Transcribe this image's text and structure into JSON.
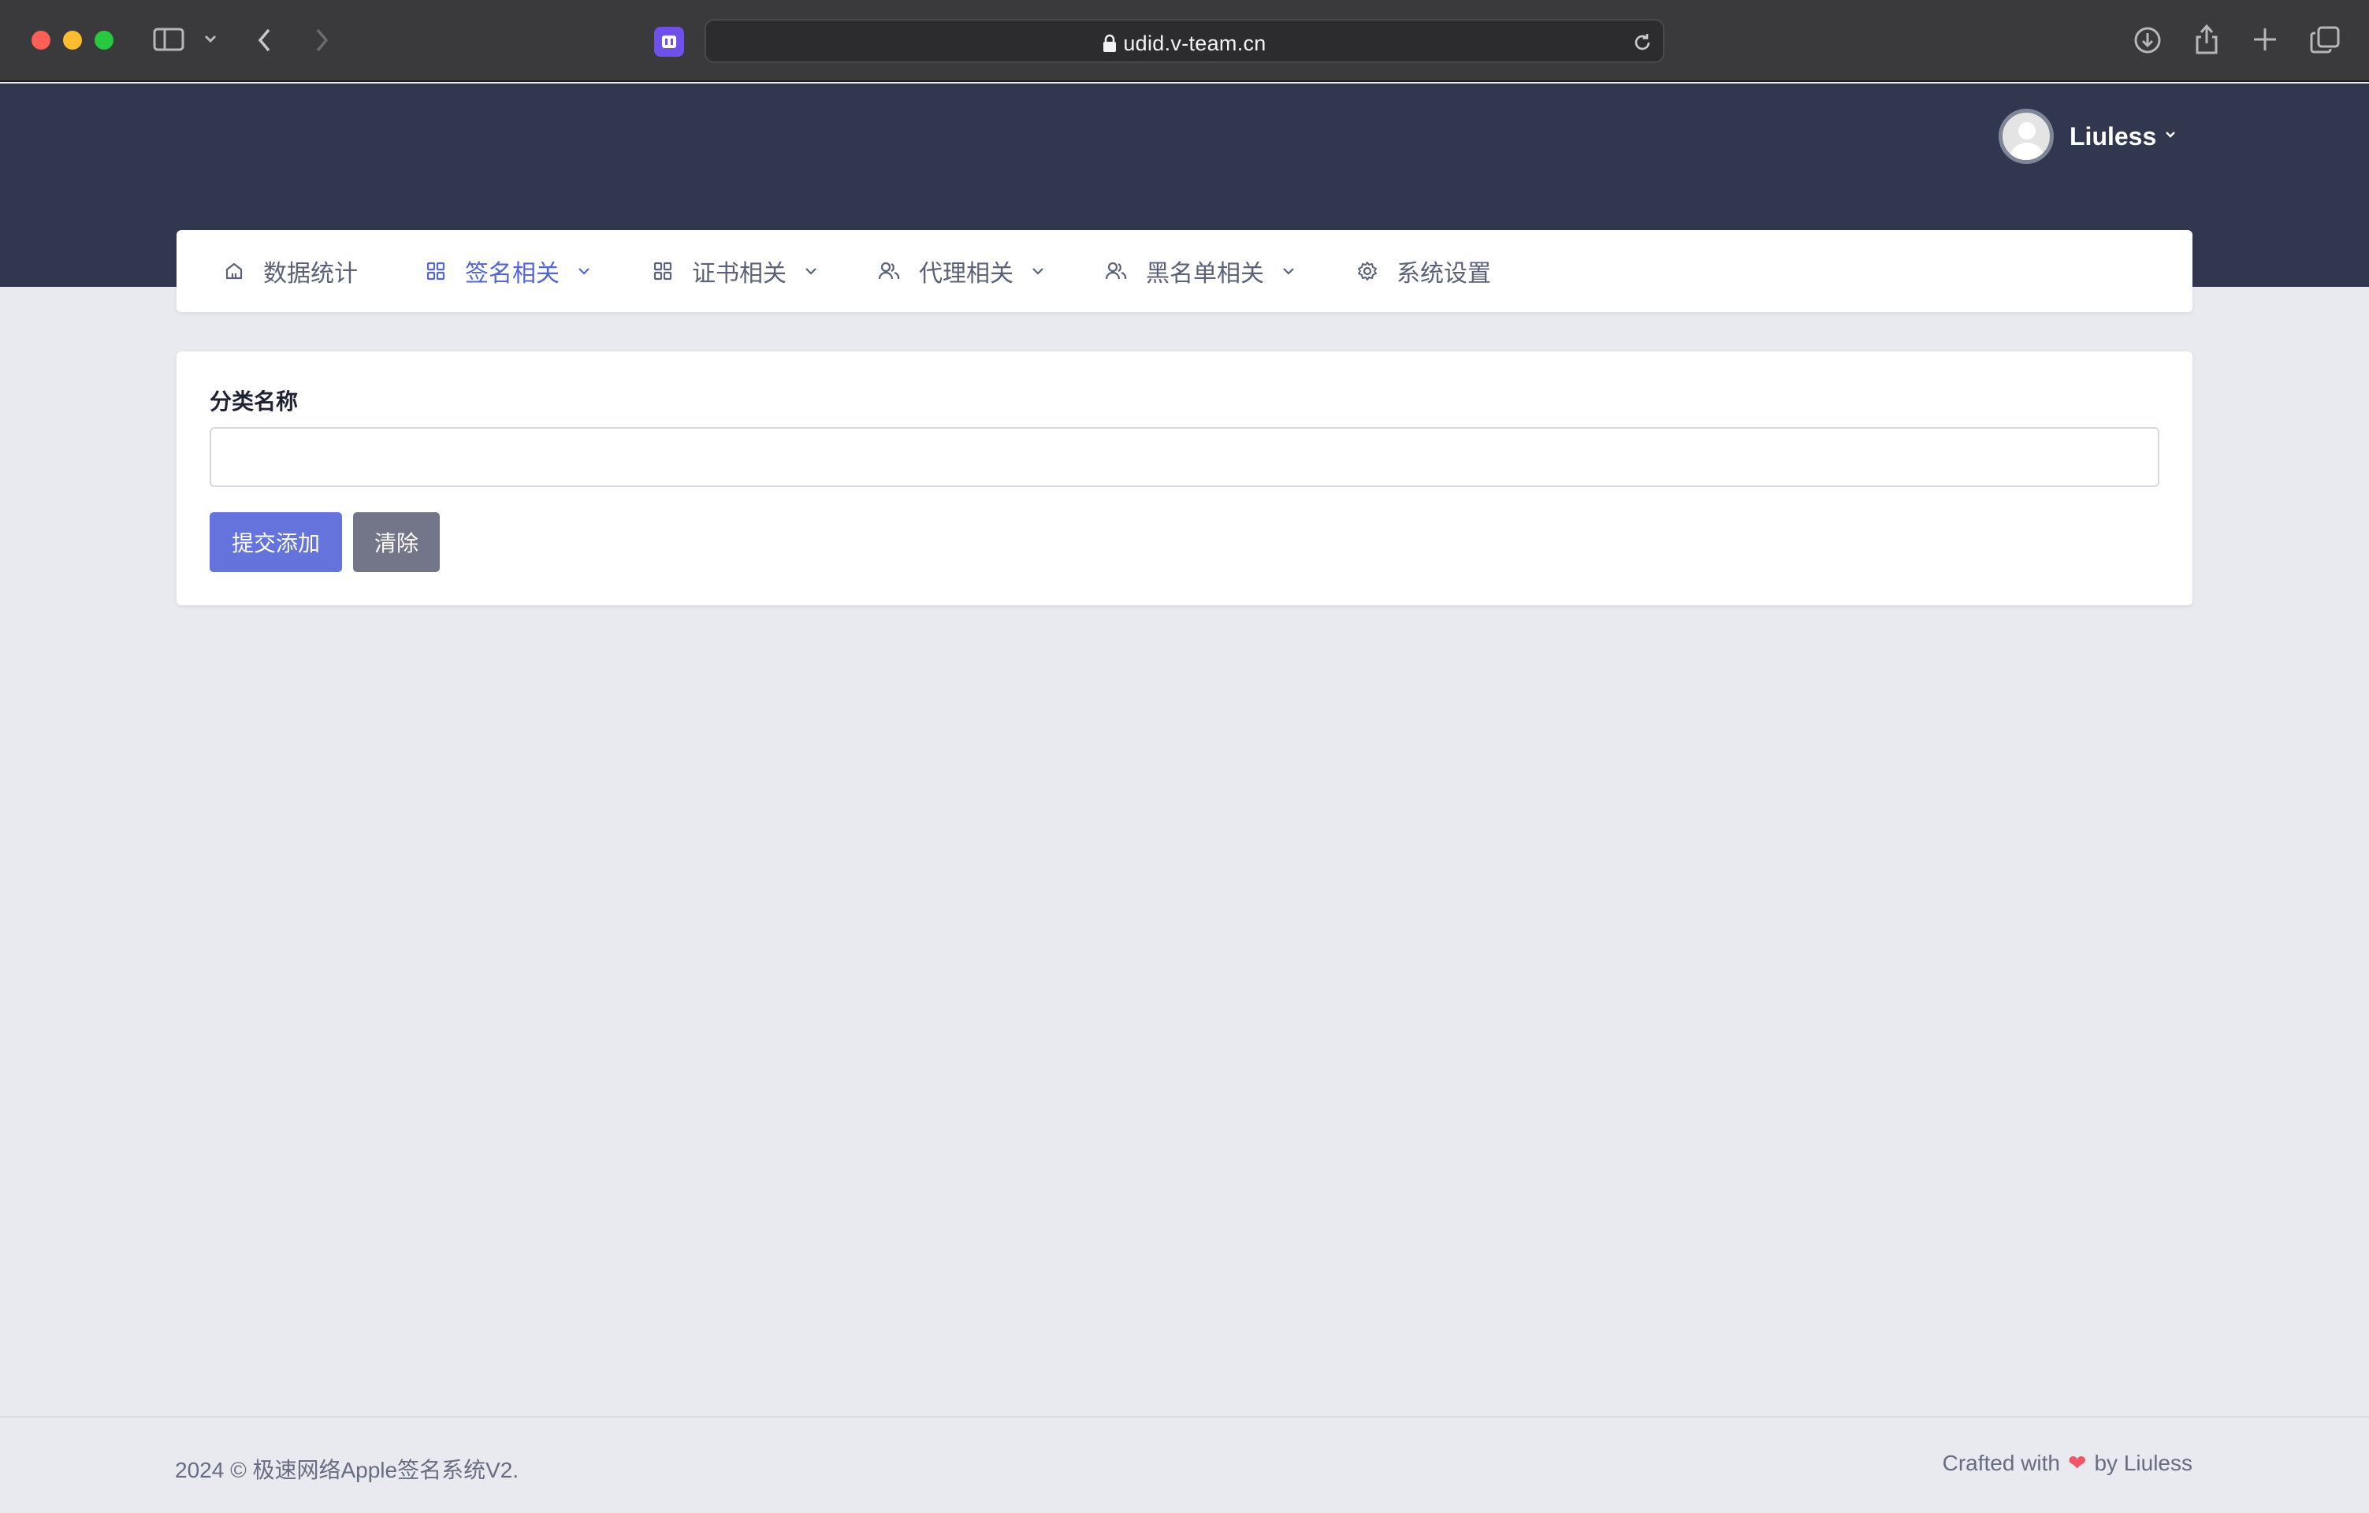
{
  "browser": {
    "url": "udid.v-team.cn"
  },
  "user": {
    "name": "Liuless"
  },
  "nav": {
    "items": [
      {
        "label": "数据统计",
        "icon": "home-icon",
        "dropdown": false,
        "active": false
      },
      {
        "label": "签名相关",
        "icon": "grid-icon",
        "dropdown": true,
        "active": true
      },
      {
        "label": "证书相关",
        "icon": "grid-icon",
        "dropdown": true,
        "active": false
      },
      {
        "label": "代理相关",
        "icon": "users-icon",
        "dropdown": true,
        "active": false
      },
      {
        "label": "黑名单相关",
        "icon": "users-icon",
        "dropdown": true,
        "active": false
      },
      {
        "label": "系统设置",
        "icon": "gear-icon",
        "dropdown": false,
        "active": false
      }
    ]
  },
  "form": {
    "label": "分类名称",
    "input_value": "",
    "submit_label": "提交添加",
    "clear_label": "清除"
  },
  "footer": {
    "copyright": "2024 © 极速网络Apple签名系统V2.",
    "crafted_prefix": "Crafted with",
    "crafted_suffix": "by Liuless"
  },
  "colors": {
    "header": "#31374f",
    "accent": "#5466d4",
    "primary_button": "#6574dc",
    "secondary_button": "#727688",
    "heart": "#ee5566"
  }
}
